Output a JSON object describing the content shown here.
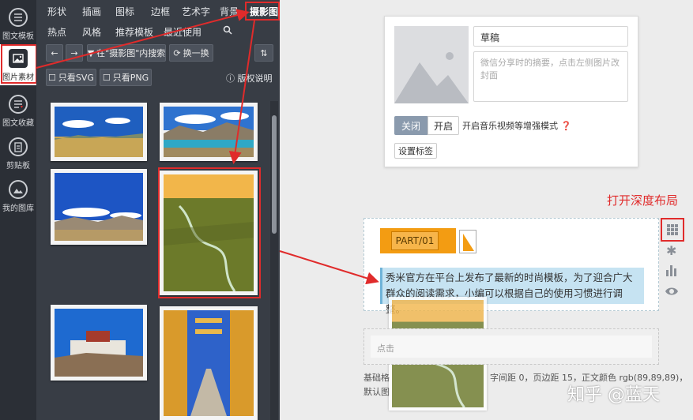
{
  "sidebar": {
    "items": [
      {
        "label": "图文模板",
        "icon": "list-icon"
      },
      {
        "label": "图片素材",
        "icon": "image-icon"
      },
      {
        "label": "图文收藏",
        "icon": "bookmark-list-icon"
      },
      {
        "label": "剪贴板",
        "icon": "clipboard-icon"
      },
      {
        "label": "我的图库",
        "icon": "mountain-icon"
      }
    ]
  },
  "menu": {
    "row1": [
      "形状",
      "插画",
      "图标",
      "边框",
      "艺术字",
      "背景",
      "摄影图"
    ],
    "row2": [
      "热点",
      "风格",
      "推荐模板",
      "最近使用"
    ]
  },
  "toolbar": {
    "search_label": "在\"摄影图\"内搜索",
    "shuffle_label": "换一换",
    "svg_filter_label": "只看SVG",
    "png_filter_label": "只看PNG",
    "copyright_label": "版权说明"
  },
  "card": {
    "title_value": "草稿",
    "summary_placeholder": "微信分享时的摘要，点击左侧图片改封面",
    "toggle_off_label": "关闭",
    "toggle_on_label": "开启",
    "music_label": "开启音乐视频等增强模式",
    "tag_button_label": "设置标签"
  },
  "annotation": {
    "deep_layout_label": "打开深度布局"
  },
  "article": {
    "part_label": "PART/01",
    "text": "秀米官方在平台上发布了最新的时尚模板，为了迎合广大群众的阅读需求，小编可以根据自己的使用习惯进行调整。"
  },
  "footer": {
    "placeholder_text": "点击",
    "format_prefix": "基础格",
    "format_text": "字间距 0，页边距 15，正文颜色 rgb(89,89,89)，",
    "default_text": "默认图"
  },
  "watermark": "知乎 @蓝天",
  "colors": {
    "accent_red": "#e02b2b",
    "part_orange": "#f39c12",
    "highlight_blue": "#c6e3f2",
    "panel_dark": "#383d45",
    "rail_dark": "#2b2f36"
  }
}
